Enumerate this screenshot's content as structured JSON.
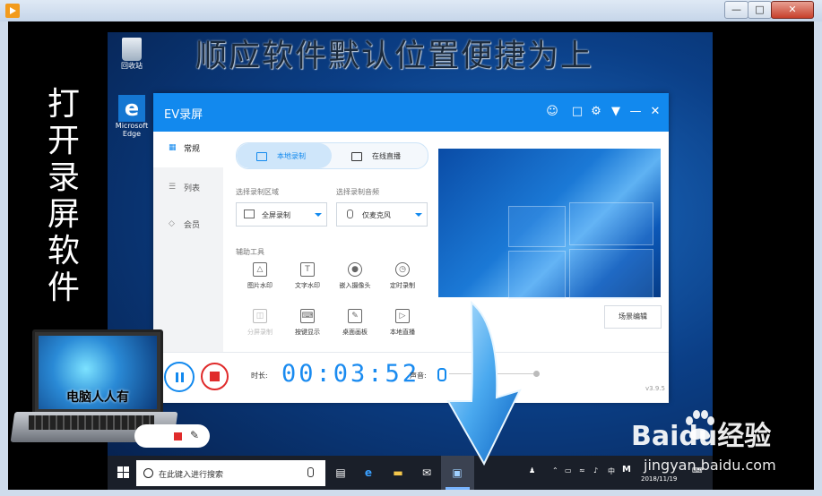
{
  "overlay": {
    "title": "顺应软件默认位置便捷为上",
    "left_text": "打开录屏软件"
  },
  "desktop": {
    "icons": [
      "回收站",
      "Microsoft Edge"
    ]
  },
  "ev_window": {
    "title": "EV录屏",
    "sidebar": [
      "常规",
      "列表",
      "会员"
    ],
    "tabs": [
      "本地录制",
      "在线直播"
    ],
    "area_label": "选择录制区域",
    "area_value": "全屏录制",
    "audio_label": "选择录制音频",
    "audio_value": "仅麦克风",
    "tools_label": "辅助工具",
    "tools": [
      "图片水印",
      "文字水印",
      "嵌入摄像头",
      "定时录制",
      "分屏录制",
      "按键显示",
      "桌面画板",
      "本地直播"
    ],
    "scene_button": "场景编辑",
    "duration_label": "时长:",
    "timer": "00:03:52",
    "volume_label": "声音:",
    "version": "v3.9.5"
  },
  "taskbar": {
    "search_placeholder": "在此键入进行搜索",
    "tray_time": "中",
    "date": "2018/11/19"
  },
  "laptop_caption": "电脑人人有",
  "watermark": {
    "logo": "Baidu经验",
    "url": "jingyan.baidu.com"
  },
  "colors": {
    "accent": "#1289ee",
    "record_red": "#e02b2b",
    "timer_blue": "#1a8bf0"
  }
}
